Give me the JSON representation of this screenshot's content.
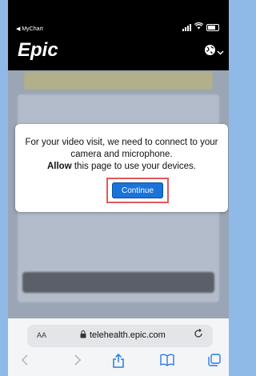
{
  "status_bar": {
    "back_label": "◀ MyChart"
  },
  "header": {
    "logo_text": "Epic",
    "language_icon": "globe-icon"
  },
  "modal": {
    "line1": "For your video visit, we need to connect to your camera and microphone.",
    "allow_word": "Allow",
    "line2_rest": " this page to use your devices.",
    "continue_label": "Continue"
  },
  "safari": {
    "aa_label": "AA",
    "url": "telehealth.epic.com"
  },
  "colors": {
    "brand_black": "#000000",
    "button_blue": "#1a73d9",
    "highlight_red": "#e05a5a",
    "safari_blue": "#2a7be0",
    "backdrop_blue": "#8fb9e6"
  }
}
